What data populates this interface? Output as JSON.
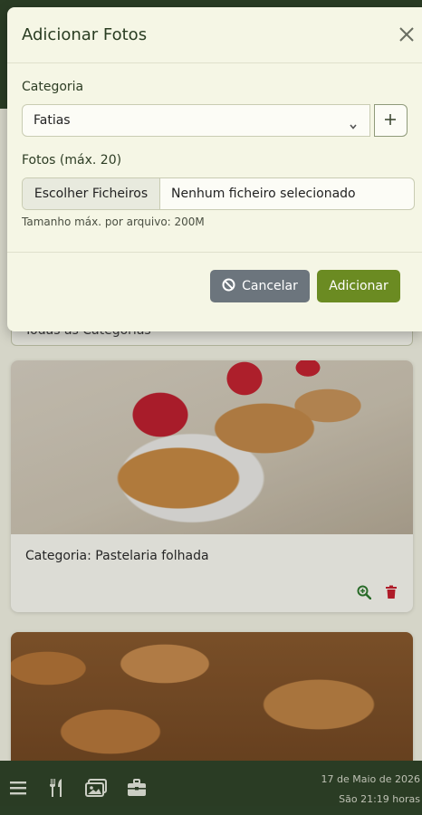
{
  "modal": {
    "title": "Adicionar Fotos",
    "category_label": "Categoria",
    "category_value": "Fatias",
    "photos_label": "Fotos (máx. 20)",
    "file_button": "Escolher Ficheiros",
    "file_status": "Nenhum ficheiro selecionado",
    "size_hint": "Tamanho máx. por arquivo: 200M",
    "cancel_label": "Cancelar",
    "add_label": "Adicionar"
  },
  "background": {
    "filter_value": "Todas as Categorias",
    "cards": [
      {
        "caption": "Categoria: Pastelaria folhada"
      }
    ]
  },
  "bottom_nav": {
    "date": "17 de Maio de 2026",
    "time": "São 21:19 horas"
  },
  "colors": {
    "header_bg": "#30452a",
    "modal_bg": "#f5f6e5",
    "primary": "#6b8b22",
    "secondary": "#6c757d",
    "zoom_icon": "#2f7a2f",
    "trash_icon": "#c8202f"
  }
}
